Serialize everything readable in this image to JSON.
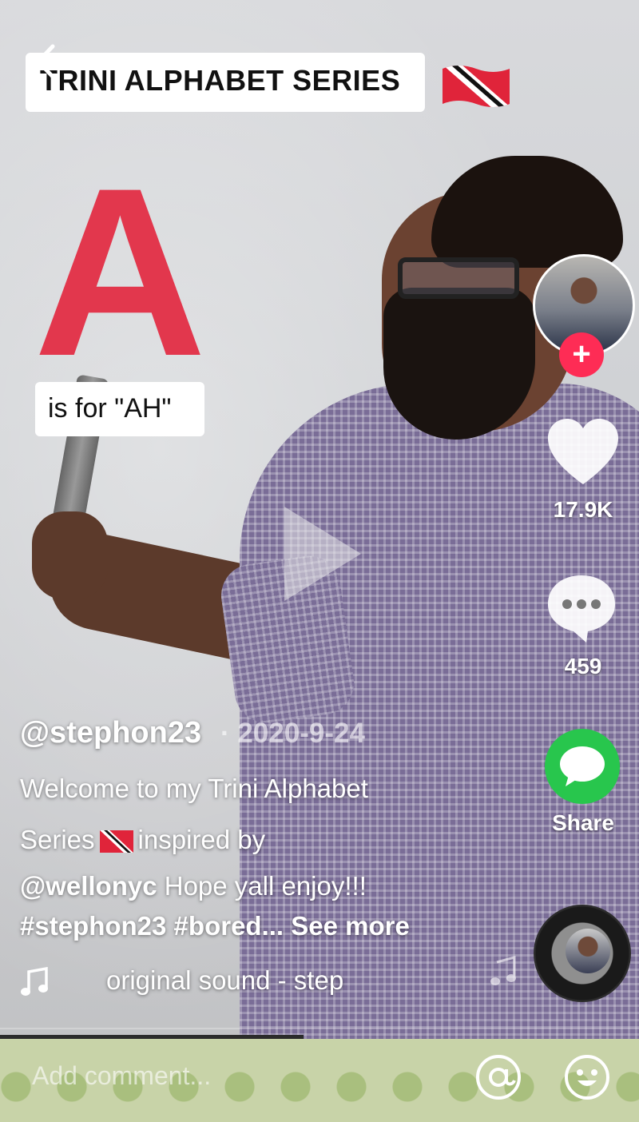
{
  "video": {
    "title_overlay": "TRINI ALPHABET SERIES",
    "big_letter": "A",
    "caption_overlay": "is for \"AH\""
  },
  "actions": {
    "likes": "17.9K",
    "comments": "459",
    "share_label": "Share",
    "follow_symbol": "+"
  },
  "post": {
    "username": "@stephon23",
    "date": "· 2020-9-24",
    "description_line1": "Welcome to my Trini Alphabet",
    "description_line2_a": "Series",
    "description_line2_b": "inspired by",
    "mention": "@wellonyc",
    "description_line3": " Hope yall enjoy!!!",
    "hashtags": "#stephon23 #bored...",
    "see_more": "See more",
    "sound": "original sound - step"
  },
  "comment_bar": {
    "placeholder": "Add comment..."
  },
  "colors": {
    "accent_red": "#fe2c55",
    "share_green": "#28c64d",
    "letter_red": "#e2374d"
  },
  "icons": [
    "back-arrow-icon",
    "trinidad-flag-icon",
    "play-icon",
    "heart-icon",
    "comment-bubble-icon",
    "share-message-icon",
    "music-note-icon",
    "at-sign-icon",
    "emoji-icon"
  ]
}
